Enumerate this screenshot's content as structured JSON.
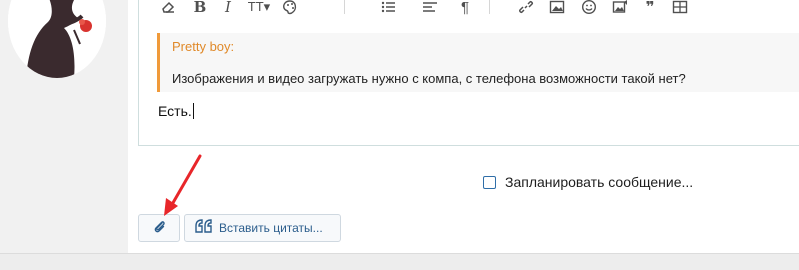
{
  "quote": {
    "author": "Pretty boy:",
    "text": "Изображения и видео загружать нужно с компа, с телефона возможности такой нет?"
  },
  "message": {
    "text": "Есть."
  },
  "schedule": {
    "label": "Запланировать сообщение..."
  },
  "buttons": {
    "insert_quotes_label": "Вставить цитаты..."
  },
  "icons": {
    "toolbar": [
      "eraser-icon",
      "bold-icon",
      "italic-icon",
      "text-size-icon",
      "palette-icon",
      "list-icon",
      "align-icon",
      "paragraph-icon",
      "link-icon",
      "image-icon",
      "smiley-icon",
      "media-icon",
      "quote-icon",
      "table-icon"
    ],
    "attach": "paperclip-icon",
    "quote_button": "double-quote-icon"
  },
  "colors": {
    "quote_accent": "#f09a3a",
    "link_blue": "#2b5d8c",
    "annotation_red": "#e8262a"
  }
}
